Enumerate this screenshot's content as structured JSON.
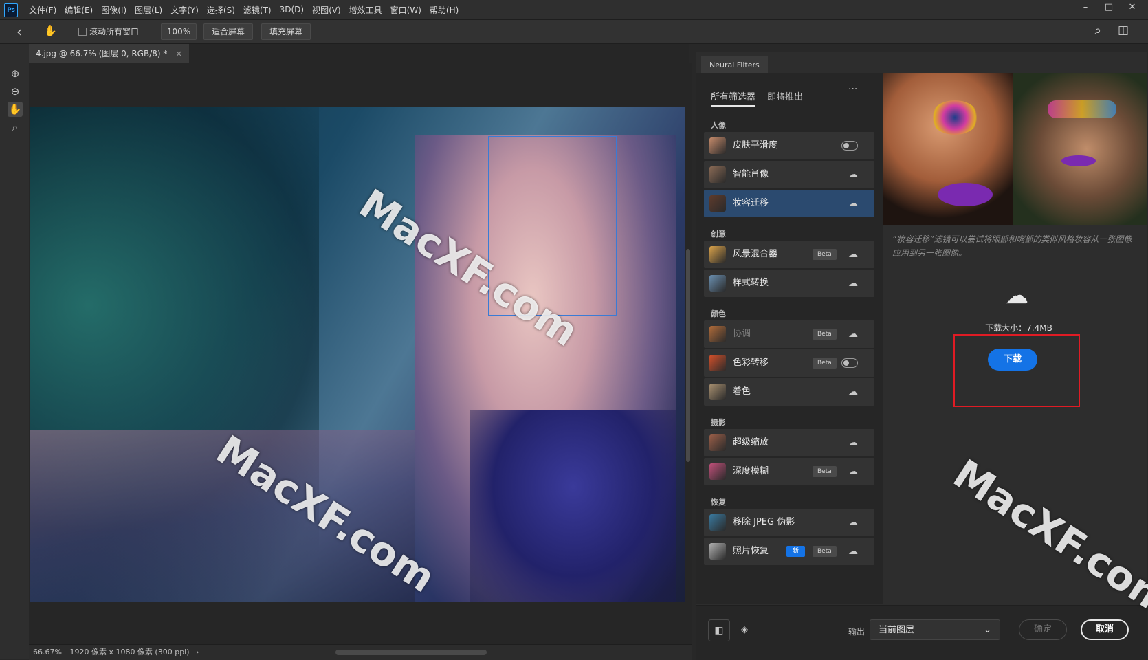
{
  "app": {
    "logo": "Ps",
    "menu": [
      "文件(F)",
      "编辑(E)",
      "图像(I)",
      "图层(L)",
      "文字(Y)",
      "选择(S)",
      "滤镜(T)",
      "3D(D)",
      "视图(V)",
      "增效工具",
      "窗口(W)",
      "帮助(H)"
    ],
    "window_controls": [
      "–",
      "□",
      "✕"
    ]
  },
  "options_bar": {
    "back": "‹",
    "hand": "✋",
    "scroll_all_windows": "滚动所有窗口",
    "zoom": "100%",
    "fit_screen": "适合屏幕",
    "fill_screen": "填充屏幕",
    "search_icon": "⌕",
    "workspace_icon": "◫"
  },
  "document": {
    "tab_title": "4.jpg @ 66.7% (图层 0, RGB/8) *",
    "close": "×",
    "status_zoom": "66.67%",
    "status_info": "1920 像素 x 1080 像素 (300 ppi)",
    "status_arrow": "›"
  },
  "tools": [
    "⊕",
    "⊖",
    "✋",
    "⌕"
  ],
  "neural_filters": {
    "panel_tab": "Neural Filters",
    "tabs": [
      "所有筛选器",
      "即将推出"
    ],
    "more": "···",
    "categories": [
      {
        "name": "人像",
        "filters": [
          {
            "label": "皮肤平滑度",
            "control": "toggle",
            "thumb_color": "#c48a6a"
          },
          {
            "label": "智能肖像",
            "control": "cloud",
            "thumb_color": "#8a6a55"
          },
          {
            "label": "妆容迁移",
            "control": "cloud",
            "active": true,
            "thumb_color": "#5e3b2c"
          }
        ]
      },
      {
        "name": "创意",
        "filters": [
          {
            "label": "风景混合器",
            "badge": "Beta",
            "control": "cloud",
            "thumb_color": "#d9a24a"
          },
          {
            "label": "样式转换",
            "control": "cloud",
            "thumb_color": "#6a8fb0"
          }
        ]
      },
      {
        "name": "颜色",
        "filters": [
          {
            "label": "协调",
            "badge": "Beta",
            "control": "cloud",
            "dim": true,
            "thumb_color": "#b06b3a"
          },
          {
            "label": "色彩转移",
            "badge": "Beta",
            "control": "toggle",
            "thumb_color": "#d4502a"
          },
          {
            "label": "着色",
            "control": "cloud",
            "thumb_color": "#a89070"
          }
        ]
      },
      {
        "name": "摄影",
        "filters": [
          {
            "label": "超级缩放",
            "control": "cloud",
            "thumb_color": "#9a5e48"
          },
          {
            "label": "深度模糊",
            "badge": "Beta",
            "control": "cloud",
            "thumb_color": "#c0507a"
          }
        ]
      },
      {
        "name": "恢复",
        "filters": [
          {
            "label": "移除 JPEG 伪影",
            "control": "cloud",
            "thumb_color": "#3a7aa0"
          },
          {
            "label": "照片恢复",
            "new_badge": "新",
            "badge": "Beta",
            "control": "cloud",
            "thumb_color": "#b0b0b0"
          }
        ]
      }
    ],
    "cloud_glyph": "☁",
    "description": "“妆容迁移”滤镜可以尝试将眼部和嘴部的类似风格妆容从一张图像应用到另一张图像。",
    "download_size": "下载大小：7.4MB",
    "download_button": "下载",
    "output_label": "输出",
    "output_value": "当前图层",
    "output_chevron": "⌄",
    "ok": "确定",
    "cancel": "取消",
    "footer_icons": [
      "◧",
      "◈"
    ]
  },
  "watermark": "MacXF.com",
  "colors": {
    "accent": "#1473e6",
    "highlight_box": "#e01b24",
    "selection_box": "#3a7bd5"
  }
}
